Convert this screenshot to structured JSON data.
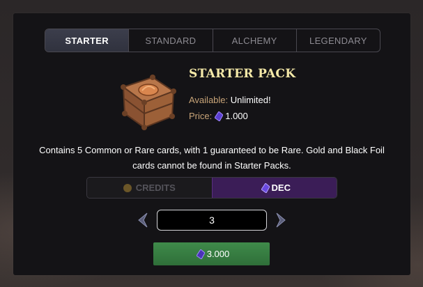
{
  "tabs": [
    {
      "label": "STARTER",
      "active": true
    },
    {
      "label": "STANDARD",
      "active": false
    },
    {
      "label": "ALCHEMY",
      "active": false
    },
    {
      "label": "LEGENDARY",
      "active": false
    }
  ],
  "pack": {
    "title": "STARTER PACK",
    "available_label": "Available:",
    "available_value": "Unlimited!",
    "price_label": "Price:",
    "price_value": "1.000",
    "price_icon": "dec-gem-icon"
  },
  "description": "Contains 5 Common or Rare cards, with 1 guaranteed to be Rare. Gold and Black Foil cards cannot be found in Starter Packs.",
  "currency": {
    "options": [
      {
        "label": "CREDITS",
        "icon": "credits-coin-icon",
        "selected": false
      },
      {
        "label": "DEC",
        "icon": "dec-gem-icon",
        "selected": true
      }
    ]
  },
  "quantity": {
    "value": "3"
  },
  "buy_button": {
    "label": "3.000",
    "icon": "dec-gem-icon"
  },
  "colors": {
    "panel_bg": "#141316",
    "title_gold": "#f5e9a8",
    "label_tan": "#c8a478",
    "dec_purple": "#3b1d57",
    "buy_green": "#3f8a4a"
  }
}
